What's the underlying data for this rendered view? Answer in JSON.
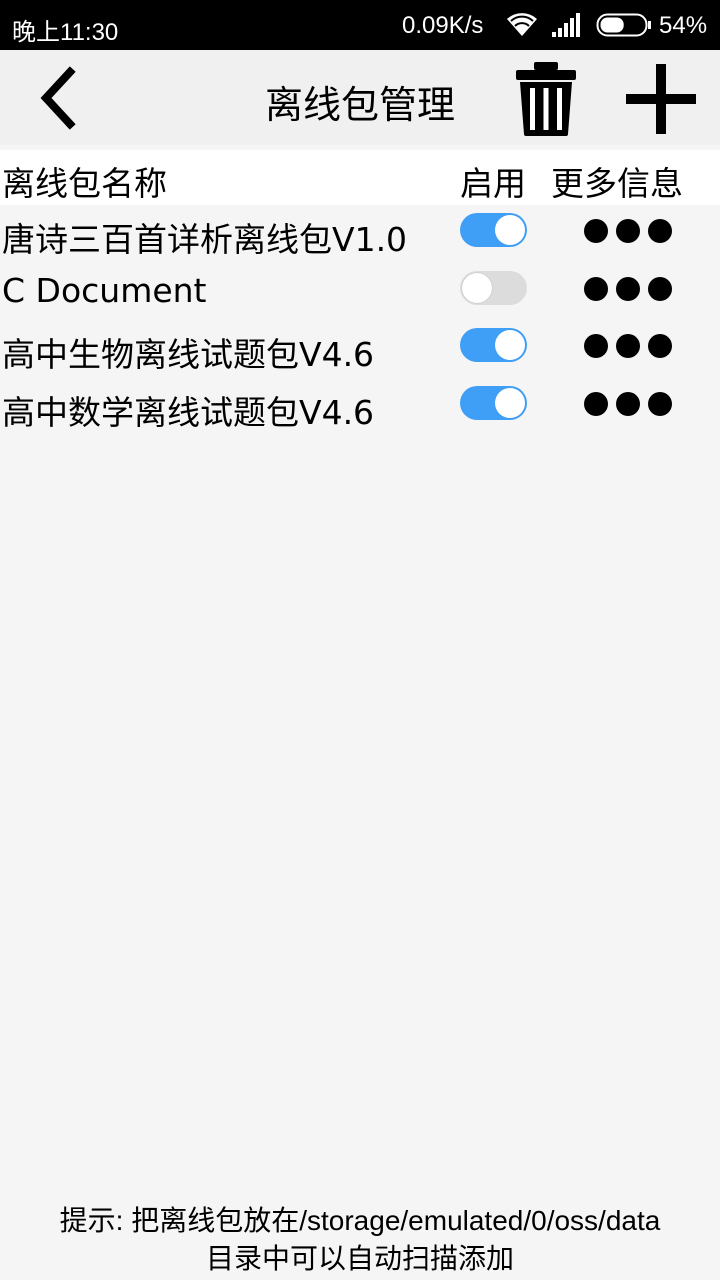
{
  "status_bar": {
    "time": "晚上11:30",
    "network_speed": "0.09K/s",
    "battery_percent": "54%",
    "battery_level": 0.54,
    "icons": [
      "wifi-icon",
      "signal-icon",
      "battery-icon"
    ]
  },
  "toolbar": {
    "title": "离线包管理",
    "back_icon": "chevron-left-icon",
    "delete_icon": "trash-icon",
    "add_icon": "plus-icon"
  },
  "header": {
    "name": "离线包名称",
    "enable": "启用",
    "more": "更多信息"
  },
  "packages": [
    {
      "name": "唐诗三百首详析离线包V1.0",
      "enabled": true
    },
    {
      "name": "C Document",
      "enabled": false
    },
    {
      "name": "高中生物离线试题包V4.6",
      "enabled": true
    },
    {
      "name": "高中数学离线试题包V4.6",
      "enabled": true
    }
  ],
  "hint": {
    "line1": "提示: 把离线包放在/storage/emulated/0/oss/data",
    "line2": "目录中可以自动扫描添加"
  },
  "colors": {
    "toggle_on": "#3f9ef5",
    "toggle_off": "#dcdcdc",
    "background": "#f5f5f5",
    "toolbar_bg": "#f0f0f0"
  }
}
